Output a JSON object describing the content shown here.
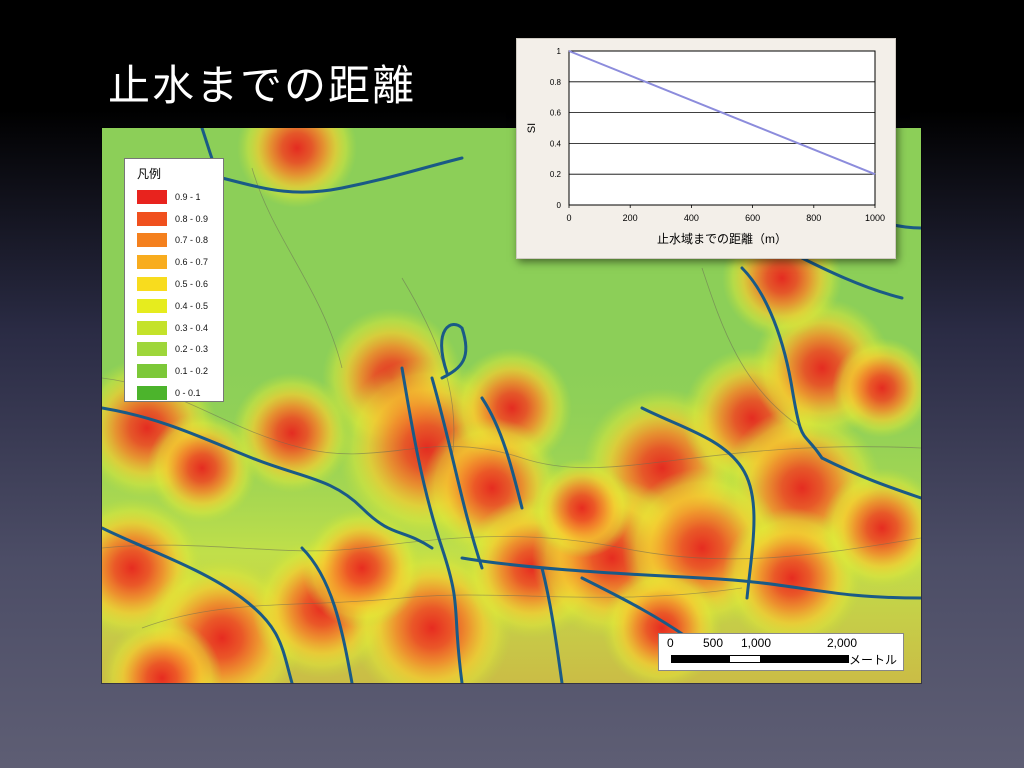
{
  "slide": {
    "title": "止水までの距離"
  },
  "legend": {
    "title": "凡例",
    "items": [
      {
        "label": "0.9 - 1",
        "color": "#e8231e"
      },
      {
        "label": "0.8 - 0.9",
        "color": "#f0501e"
      },
      {
        "label": "0.7 - 0.8",
        "color": "#f4801e"
      },
      {
        "label": "0.6 - 0.7",
        "color": "#f8ac1e"
      },
      {
        "label": "0.5 - 0.6",
        "color": "#f8dc1e"
      },
      {
        "label": "0.4 - 0.5",
        "color": "#e6ec1e"
      },
      {
        "label": "0.3 - 0.4",
        "color": "#c4e22a"
      },
      {
        "label": "0.2 - 0.3",
        "color": "#9ed63a"
      },
      {
        "label": "0.1 - 0.2",
        "color": "#7cc838"
      },
      {
        "label": "0 - 0.1",
        "color": "#4cb42c"
      }
    ]
  },
  "scalebar": {
    "labels": [
      "0",
      "500",
      "1,000",
      "2,000"
    ],
    "unit": "メートル"
  },
  "colors": {
    "water": "#1a5a86",
    "road": "#555555"
  },
  "chart_data": {
    "type": "line",
    "xlabel": "止水域までの距離（m）",
    "ylabel": "SI",
    "xlim": [
      0,
      1000
    ],
    "ylim": [
      0,
      1
    ],
    "xticks": [
      0,
      200,
      400,
      600,
      800,
      1000
    ],
    "yticks": [
      0,
      0.2,
      0.4,
      0.6,
      0.8,
      1
    ],
    "grid": "horizontal",
    "series": [
      {
        "x": [
          0,
          1000
        ],
        "y": [
          1,
          0.2
        ],
        "color": "#8c8cdc"
      }
    ]
  }
}
